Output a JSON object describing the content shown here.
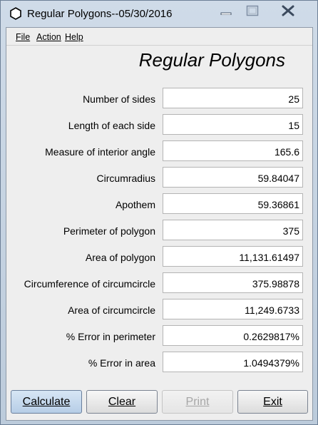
{
  "window": {
    "title": "Regular Polygons--05/30/2016"
  },
  "menu": {
    "items": [
      "File",
      "Action",
      "Help"
    ]
  },
  "heading": "Regular Polygons",
  "rows": [
    {
      "label": "Number of sides",
      "value": "25"
    },
    {
      "label": "Length of each side",
      "value": "15"
    },
    {
      "label": "Measure of interior angle",
      "value": "165.6"
    },
    {
      "label": "Circumradius",
      "value": "59.84047"
    },
    {
      "label": "Apothem",
      "value": "59.36861"
    },
    {
      "label": "Perimeter of polygon",
      "value": "375"
    },
    {
      "label": "Area of polygon",
      "value": "11,131.61497"
    },
    {
      "label": "Circumference of circumcircle",
      "value": "375.98878"
    },
    {
      "label": "Area of circumcircle",
      "value": "11,249.6733"
    },
    {
      "label": "% Error in perimeter",
      "value": "0.2629817%"
    },
    {
      "label": "% Error in area",
      "value": "1.0494379%"
    }
  ],
  "buttons": {
    "calculate": "Calculate",
    "clear": "Clear",
    "print": "Print",
    "exit": "Exit"
  }
}
